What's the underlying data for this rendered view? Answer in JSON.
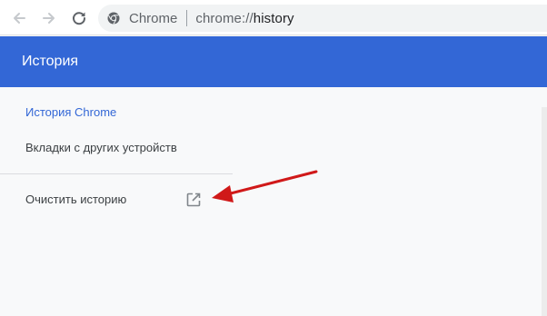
{
  "browser": {
    "back_icon": "arrow-left-icon",
    "forward_icon": "arrow-right-icon",
    "reload_icon": "reload-icon",
    "site_icon": "chrome-logo-icon",
    "omnibox_label": "Chrome",
    "url_scheme": "chrome://",
    "url_path": "history"
  },
  "header": {
    "title": "История"
  },
  "sidebar": {
    "items": [
      {
        "label": "История Chrome",
        "selected": true
      },
      {
        "label": "Вкладки с других устройств",
        "selected": false
      }
    ],
    "clear_history_label": "Очистить историю",
    "clear_history_icon": "open-in-new-icon"
  },
  "colors": {
    "header_bg": "#3367d6",
    "selected_text": "#3367d6",
    "annotation_arrow": "#d01919"
  },
  "annotation": {
    "type": "red-arrow",
    "target": "clear-history"
  }
}
